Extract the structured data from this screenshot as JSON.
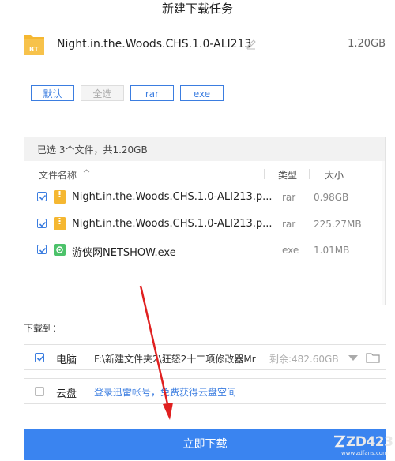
{
  "dialog": {
    "title": "新建下载任务"
  },
  "torrent": {
    "icon_label": "BT",
    "name": "Night.in.the.Woods.CHS.1.0-ALI213",
    "size": "1.20GB"
  },
  "filters": [
    {
      "label": "默认",
      "active": true
    },
    {
      "label": "全选",
      "active": false
    },
    {
      "label": "rar",
      "active": true
    },
    {
      "label": "exe",
      "active": true
    }
  ],
  "file_list": {
    "summary": "已选 3个文件，共1.20GB",
    "columns": {
      "name": "文件名称",
      "sort_icon": "sort-icon",
      "type": "类型",
      "size": "大小"
    },
    "files": [
      {
        "name": "Night.in.the.Woods.CHS.1.0-ALI213.p...",
        "type": "rar",
        "size": "0.98GB",
        "icon": "zip-file-icon",
        "checked": true
      },
      {
        "name": "Night.in.the.Woods.CHS.1.0-ALI213.p...",
        "type": "rar",
        "size": "225.27MB",
        "icon": "zip-file-icon",
        "checked": true
      },
      {
        "name": "游侠网NETSHOW.exe",
        "type": "exe",
        "size": "1.01MB",
        "icon": "exe-file-icon",
        "checked": true
      }
    ]
  },
  "download_to": {
    "label": "下载到：",
    "computer": {
      "label": "电脑",
      "path": "F:\\新建文件夹2\\狂怒2十二项修改器Mr",
      "free": "剩余:482.60GB",
      "checked": true
    },
    "cloud": {
      "label": "云盘",
      "link": "登录迅雷帐号，免费获得云盘空间",
      "checked": false
    }
  },
  "primary_button": {
    "label": "立即下载"
  },
  "watermark": {
    "text": "ZD423",
    "url": "www.zdfans.com"
  },
  "colors": {
    "accent": "#3a84f0",
    "link": "#3b7de0",
    "annotation_arrow": "#e02020",
    "folder": "#f5b731"
  }
}
